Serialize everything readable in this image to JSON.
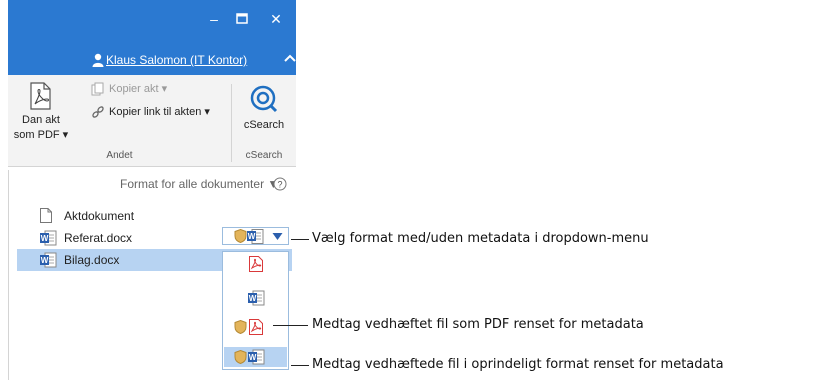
{
  "window": {
    "minimize_glyph": "‒",
    "maximize_glyph": "☐",
    "close_glyph": "✕"
  },
  "user": {
    "name": "Klaus Salomon (IT Kontor)",
    "icon": "user-icon",
    "collapse_icon": "chevron-up-icon"
  },
  "ribbon": {
    "dan_akt_line1": "Dan akt",
    "dan_akt_line2": "som PDF ▾",
    "kopier_akt": "Kopier akt ▾",
    "kopier_link": "Kopier link til akten ▾",
    "csearch_button": "cSearch",
    "group_andet": "Andet",
    "group_csearch": "cSearch"
  },
  "documents": {
    "format_all_label": "Format for alle dokumenter ▼",
    "help_icon": "?",
    "items": [
      {
        "label": "Aktdokument",
        "icon": "document-icon"
      },
      {
        "label": "Referat.docx",
        "icon": "word-icon"
      },
      {
        "label": "Bilag.docx",
        "icon": "word-icon",
        "selected": true
      }
    ]
  },
  "format_dropdown": {
    "options": [
      "pdf-icon",
      "word-icon",
      "shield-pdf-icon",
      "shield-word-icon"
    ],
    "selected_index": 3
  },
  "callouts": {
    "dropdown": "Vælg format med/uden metadata i dropdown-menu",
    "pdf_clean": "Medtag vedhæftet fil som PDF renset for metadata",
    "original_clean": "Medtag vedhæftede fil i oprindeligt format renset for metadata"
  },
  "colors": {
    "titlebar": "#2b79d1",
    "selection": "#b7d3f2",
    "pdf_red": "#d9393a",
    "word_blue": "#2b5fad",
    "shield_gold": "#e3b45a",
    "csearch_blue": "#1f6fc1"
  }
}
